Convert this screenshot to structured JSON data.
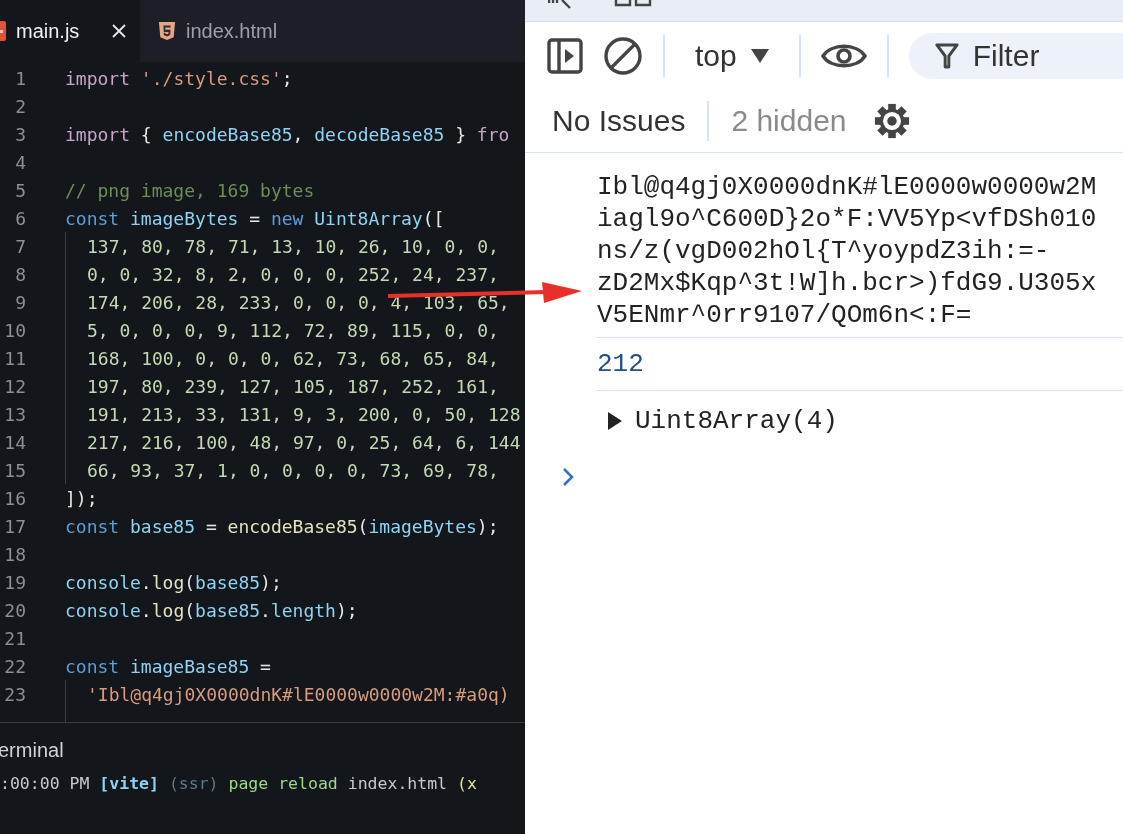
{
  "editor": {
    "tabs": [
      {
        "label": "main.js",
        "selected": true
      },
      {
        "label": "index.html",
        "selected": false
      }
    ],
    "lines": [
      {
        "number": "1",
        "tokens": [
          {
            "kind": "keyword",
            "text": "import"
          },
          {
            "kind": "string",
            "text": " './style.css'"
          },
          {
            "kind": "plain",
            "text": ";"
          }
        ]
      },
      {
        "number": "2"
      },
      {
        "number": "3",
        "tokens": [
          {
            "kind": "keyword",
            "text": "import"
          },
          {
            "kind": "plain",
            "text": " { "
          },
          {
            "kind": "variable",
            "text": "encodeBase85"
          },
          {
            "kind": "plain",
            "text": ", "
          },
          {
            "kind": "variable",
            "text": "decodeBase85"
          },
          {
            "kind": "plain",
            "text": " } "
          },
          {
            "kind": "keyword",
            "text": "fro"
          }
        ]
      },
      {
        "number": "4"
      },
      {
        "number": "5",
        "tokens": [
          {
            "kind": "comment",
            "text": "// png image, 169 bytes"
          }
        ]
      },
      {
        "number": "6",
        "tokens": [
          {
            "kind": "storage",
            "text": "const"
          },
          {
            "kind": "variable",
            "text": " imageBytes"
          },
          {
            "kind": "plain",
            "text": " = "
          },
          {
            "kind": "storage",
            "text": "new"
          },
          {
            "kind": "variable",
            "text": " Uint8Array"
          },
          {
            "kind": "plain",
            "text": "(["
          }
        ],
        "children": [
          {
            "number": "7",
            "tokens": [
              {
                "kind": "number",
                "text": "137, 80, 78, 71, 13, 10, 26, 10, 0, 0,"
              }
            ]
          },
          {
            "number": "8",
            "tokens": [
              {
                "kind": "number",
                "text": "0, 0, 32, 8, 2, 0, 0, 0, 252, 24, 237,"
              }
            ]
          },
          {
            "number": "9",
            "tokens": [
              {
                "kind": "number",
                "text": "174, 206, 28, 233, 0, 0, 0, 4, 103, 65,"
              }
            ]
          },
          {
            "number": "10",
            "tokens": [
              {
                "kind": "number",
                "text": "5, 0, 0, 0, 9, 112, 72, 89, 115, 0, 0,"
              }
            ]
          },
          {
            "number": "11",
            "tokens": [
              {
                "kind": "number",
                "text": "168, 100, 0, 0, 0, 62, 73, 68, 65, 84,"
              }
            ]
          },
          {
            "number": "12",
            "tokens": [
              {
                "kind": "number",
                "text": "197, 80, 239, 127, 105, 187, 252, 161,"
              }
            ]
          },
          {
            "number": "13",
            "tokens": [
              {
                "kind": "number",
                "text": "191, 213, 33, 131, 9, 3, 200, 0, 50, 128"
              }
            ]
          },
          {
            "number": "14",
            "tokens": [
              {
                "kind": "number",
                "text": "217, 216, 100, 48, 97, 0, 25, 64, 6, 144"
              }
            ]
          },
          {
            "number": "15",
            "tokens": [
              {
                "kind": "number",
                "text": "66, 93, 37, 1, 0, 0, 0, 0, 73, 69, 78,"
              }
            ]
          }
        ]
      },
      {
        "number": "16",
        "tokens": [
          {
            "kind": "plain",
            "text": "]);"
          }
        ]
      },
      {
        "number": "17",
        "tokens": [
          {
            "kind": "storage",
            "text": "const"
          },
          {
            "kind": "variable",
            "text": " base85"
          },
          {
            "kind": "plain",
            "text": " = "
          },
          {
            "kind": "function",
            "text": "encodeBase85"
          },
          {
            "kind": "plain",
            "text": "("
          },
          {
            "kind": "variable",
            "text": "imageBytes"
          },
          {
            "kind": "plain",
            "text": ");"
          }
        ]
      },
      {
        "number": "18"
      },
      {
        "number": "19",
        "tokens": [
          {
            "kind": "variable",
            "text": "console"
          },
          {
            "kind": "plain",
            "text": "."
          },
          {
            "kind": "function",
            "text": "log"
          },
          {
            "kind": "plain",
            "text": "("
          },
          {
            "kind": "variable",
            "text": "base85"
          },
          {
            "kind": "plain",
            "text": ");"
          }
        ]
      },
      {
        "number": "20",
        "tokens": [
          {
            "kind": "variable",
            "text": "console"
          },
          {
            "kind": "plain",
            "text": "."
          },
          {
            "kind": "function",
            "text": "log"
          },
          {
            "kind": "plain",
            "text": "("
          },
          {
            "kind": "variable",
            "text": "base85"
          },
          {
            "kind": "plain",
            "text": "."
          },
          {
            "kind": "variable",
            "text": "length"
          },
          {
            "kind": "plain",
            "text": ");"
          }
        ]
      },
      {
        "number": "21"
      },
      {
        "number": "22",
        "tokens": [
          {
            "kind": "storage",
            "text": "const"
          },
          {
            "kind": "variable",
            "text": " imageBase85"
          },
          {
            "kind": "plain",
            "text": " ="
          }
        ],
        "children": [
          {
            "number": "23",
            "tokens": [
              {
                "kind": "string",
                "text": "'Ibl@q4gj0X0000dnK#lE0000w0000w2M:#a0q)"
              }
            ]
          }
        ]
      }
    ],
    "terminal": {
      "title": "erminal",
      "tokens": [
        {
          "kind": "dim",
          "text": ":00:00 PM "
        },
        {
          "kind": "tag",
          "text": "[vite]"
        },
        {
          "kind": "faint",
          "text": " (ssr)"
        },
        {
          "kind": "green",
          "text": " page reload"
        },
        {
          "kind": "dim",
          "text": " index.html"
        },
        {
          "kind": "yellow",
          "text": " (x"
        }
      ]
    }
  },
  "devtools": {
    "context": "top",
    "filter": {
      "placeholder": "Filter"
    },
    "issues": "No Issues",
    "hidden": "2 hidden",
    "messages": [
      {
        "kind": "text",
        "lines": [
          "Ibl@q4gj0X0000dnK#lE0000w0000w2M",
          "iagl9o^C600D}2o*F:VV5Yp<vfDSh010",
          "ns/z(vgD002hOl{T^yoypdZ3ih:=-",
          "zD2Mx$Kqp^3t!W]h.bcr>)fdG9.U305x",
          "V5ENmr^0rr9107/QOm6n<:F="
        ]
      },
      {
        "kind": "number",
        "text": "212"
      },
      {
        "kind": "object",
        "text": "Uint8Array(4)",
        "expanded": false
      }
    ]
  }
}
